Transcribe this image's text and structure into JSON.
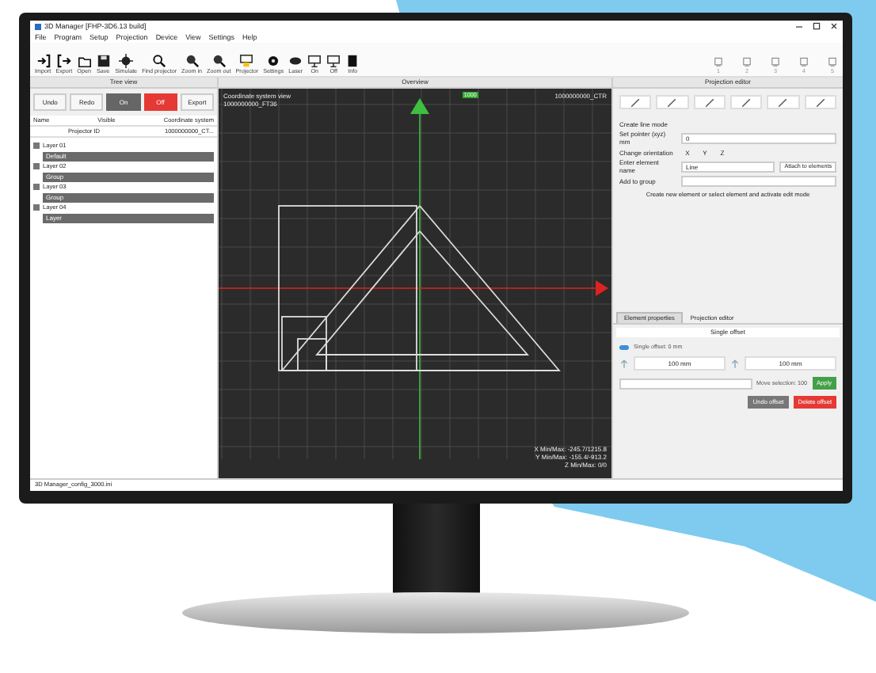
{
  "window": {
    "title": "3D Manager [FHP-3D6.13 build]"
  },
  "menu": [
    "File",
    "Program",
    "Setup",
    "Projection",
    "Device",
    "View",
    "Settings",
    "Help"
  ],
  "toolbar": [
    {
      "label": "Import"
    },
    {
      "label": "Export"
    },
    {
      "label": "Open"
    },
    {
      "label": "Save"
    },
    {
      "label": "Simulate"
    },
    {
      "label": "Find projector"
    },
    {
      "label": "Zoom in"
    },
    {
      "label": "Zoom out"
    },
    {
      "label": "Projector"
    },
    {
      "label": "Settings"
    },
    {
      "label": "Laser"
    },
    {
      "label": "On"
    },
    {
      "label": "Off"
    },
    {
      "label": "Info"
    }
  ],
  "channels": [
    "1",
    "2",
    "3",
    "4",
    "5"
  ],
  "tree_view": {
    "title": "Tree view",
    "buttons": [
      {
        "label": "Undo",
        "kind": "plain"
      },
      {
        "label": "Redo",
        "kind": "plain"
      },
      {
        "label": "On",
        "kind": "dark"
      },
      {
        "label": "Off",
        "kind": "red"
      },
      {
        "label": "Export",
        "kind": "plain"
      }
    ],
    "columns": [
      "Name",
      "Visible",
      "Coordinate system"
    ],
    "sub_columns": [
      "Projector ID",
      "1000000000_CT..."
    ],
    "items": [
      {
        "label": "Layer 01",
        "expanded": true,
        "children": [
          {
            "label": "Default",
            "selected": true
          }
        ]
      },
      {
        "label": "Layer 02",
        "expanded": true,
        "children": [
          {
            "label": "Group",
            "selected": true
          }
        ]
      },
      {
        "label": "Layer 03",
        "expanded": true,
        "children": [
          {
            "label": "Group",
            "selected": true
          }
        ]
      },
      {
        "label": "Layer 04",
        "expanded": true,
        "children": [
          {
            "label": "Layer",
            "selected": true
          }
        ]
      }
    ]
  },
  "overview": {
    "title": "Overview",
    "heading": "Coordinate system view",
    "subheading": "1000000000_FT36",
    "axis_label": "1000",
    "corner_label": "1000000000_CTR",
    "readouts": [
      "X Min/Max: -245.7/1215.8",
      "Y Min/Max: -155.4/-913.2",
      "Z Min/Max: 0/0"
    ]
  },
  "projection_editor": {
    "title": "Projection editor",
    "fields": [
      {
        "label": "Create line mode",
        "kind": "text"
      },
      {
        "label": "Set pointer (xyz) mm",
        "kind": "input",
        "value": "0"
      },
      {
        "label": "Change orientation",
        "kind": "axes",
        "options": [
          "X",
          "Y",
          "Z"
        ]
      },
      {
        "label": "Enter element name",
        "kind": "input_button",
        "value": "Line",
        "button": "Attach to elements"
      },
      {
        "label": "Add to group",
        "kind": "select"
      }
    ],
    "hint": "Create new element or select element and activate edit mode",
    "tabs": [
      {
        "label": "Element properties",
        "selected": true
      },
      {
        "label": "Projection editor",
        "selected": false
      }
    ],
    "offset_header": "Single offset",
    "offset_toggle": {
      "label": "Single offset: 0 mm",
      "on": true
    },
    "offset_values": [
      "100 mm",
      "100 mm"
    ],
    "move_label": "Move selection: 100",
    "apply": "Apply",
    "undo": "Undo offset",
    "delete": "Delete offset"
  },
  "status_bar": "3D Manager_config_3000.ini"
}
